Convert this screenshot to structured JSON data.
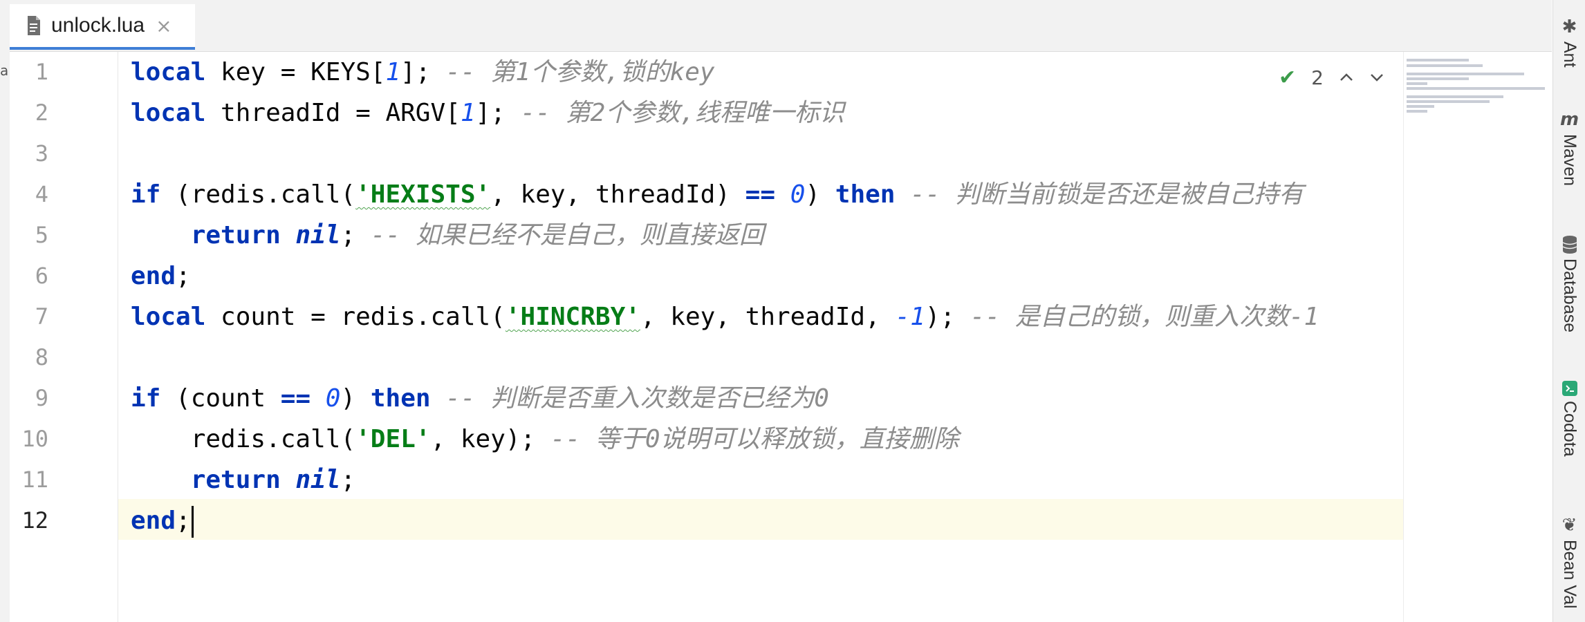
{
  "tab": {
    "filename": "unlock.lua",
    "close_glyph": "×"
  },
  "left_edge_char": "a",
  "inspection": {
    "count": "2"
  },
  "lines": [
    {
      "no": "1",
      "code": "local key = KEYS[1]; -- 第1个参数,锁的key"
    },
    {
      "no": "2",
      "code": "local threadId = ARGV[1]; -- 第2个参数,线程唯一标识"
    },
    {
      "no": "3",
      "code": ""
    },
    {
      "no": "4",
      "code": "if (redis.call('HEXISTS', key, threadId) == 0) then -- 判断当前锁是否还是被自己持有"
    },
    {
      "no": "5",
      "code": "    return nil; -- 如果已经不是自己，则直接返回"
    },
    {
      "no": "6",
      "code": "end;"
    },
    {
      "no": "7",
      "code": "local count = redis.call('HINCRBY', key, threadId, -1); -- 是自己的锁，则重入次数-1"
    },
    {
      "no": "8",
      "code": ""
    },
    {
      "no": "9",
      "code": "if (count == 0) then -- 判断是否重入次数是否已经为0"
    },
    {
      "no": "10",
      "code": "    redis.call('DEL', key); -- 等于0说明可以释放锁，直接删除"
    },
    {
      "no": "11",
      "code": "    return nil;"
    },
    {
      "no": "12",
      "code": "end;"
    }
  ],
  "tokens": {
    "l1": {
      "kw": "local",
      "a": " key = KEYS[",
      "n": "1",
      "b": "];",
      "c": " -- 第1个参数,锁的key"
    },
    "l2": {
      "kw": "local",
      "a": " threadId = ARGV[",
      "n": "1",
      "b": "];",
      "c": " -- 第2个参数,线程唯一标识"
    },
    "l4": {
      "kw": "if",
      "a": " (redis.call(",
      "s": "'HEXISTS'",
      "b": ", key, threadId) ",
      "op": "==",
      "sp": " ",
      "n": "0",
      "c2": ") ",
      "kw2": "then",
      "c": " -- 判断当前锁是否还是被自己持有"
    },
    "l5": {
      "ind": "    ",
      "kw": "return",
      "sp": " ",
      "nil": "nil",
      "b": ";",
      "c": " -- 如果已经不是自己，则直接返回"
    },
    "l6": {
      "kw": "end",
      "b": ";"
    },
    "l7": {
      "kw": "local",
      "a": " count = redis.call(",
      "s": "'HINCRBY'",
      "b": ", key, threadId, ",
      "n": "-1",
      "c2": ");",
      "c": " -- 是自己的锁，则重入次数-1"
    },
    "l9": {
      "kw": "if",
      "a": " (count ",
      "op": "==",
      "sp": " ",
      "n": "0",
      "c2": ") ",
      "kw2": "then",
      "c": " -- 判断是否重入次数是否已经为0"
    },
    "l10": {
      "ind": "    ",
      "a": "redis.call(",
      "s": "'DEL'",
      "b": ", key);",
      "c": " -- 等于0说明可以释放锁，直接删除"
    },
    "l11": {
      "ind": "    ",
      "kw": "return",
      "sp": " ",
      "nil": "nil",
      "b": ";"
    },
    "l12": {
      "kw": "end",
      "b": ";"
    }
  },
  "right_toolbar": [
    {
      "label": "Ant",
      "icon": "ant-icon"
    },
    {
      "label": "Maven",
      "icon": "maven-icon"
    },
    {
      "label": "Database",
      "icon": "database-icon"
    },
    {
      "label": "Codota",
      "icon": "codota-icon"
    },
    {
      "label": "Bean Val",
      "icon": "bean-validation-icon"
    }
  ]
}
